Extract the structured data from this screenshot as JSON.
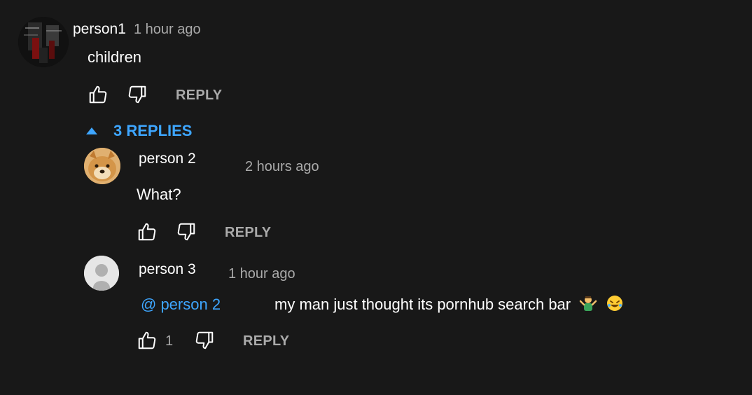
{
  "comment": {
    "author": "person1",
    "time": "1 hour ago",
    "text": "children",
    "reply_label": "REPLY",
    "replies_toggle": "3 REPLIES"
  },
  "replies": [
    {
      "author": "person 2",
      "time": "2 hours ago",
      "text": "What?",
      "reply_label": "REPLY"
    },
    {
      "author": "person 3",
      "time": "1 hour ago",
      "mention": "@ person 2",
      "text": "my man just thought its pornhub search bar",
      "likes": "1",
      "reply_label": "REPLY"
    }
  ],
  "colors": {
    "background": "#181818",
    "link": "#3ea6ff",
    "secondary": "#aaaaaa"
  }
}
